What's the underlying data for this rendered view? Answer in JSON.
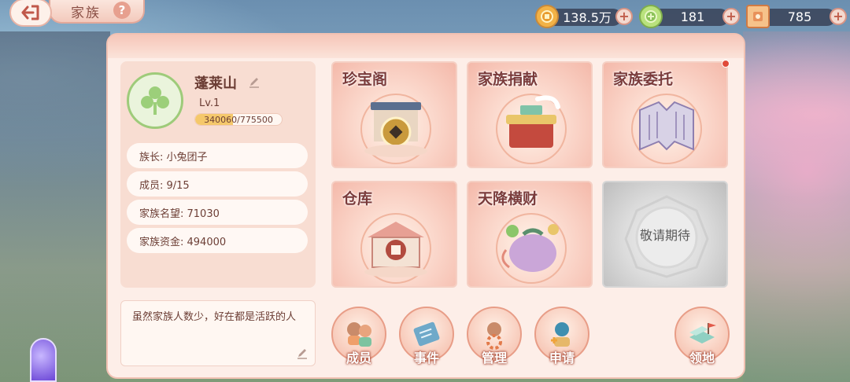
{
  "header": {
    "title": "家族",
    "help_label": "?"
  },
  "currencies": [
    {
      "icon": "gold-coin-icon",
      "value": "138.5万",
      "color": "#e7a33c"
    },
    {
      "icon": "jade-coin-icon",
      "value": "181",
      "color": "#9ccf5e"
    },
    {
      "icon": "scroll-ticket-icon",
      "value": "785",
      "color": "#e8915a"
    }
  ],
  "family": {
    "name": "蓬莱山",
    "level": "Lv.1",
    "exp_text": "340060/775500",
    "exp_fraction": 0.4385,
    "info_rows": [
      {
        "label": "族长: 小兔团子"
      },
      {
        "label": "成员: 9/15"
      },
      {
        "label": "家族名望: 71030"
      },
      {
        "label": "家族资金: 494000"
      }
    ],
    "notice": "虽然家族人数少，好在都是活跃的人"
  },
  "tiles": [
    {
      "title": "珍宝阁"
    },
    {
      "title": "家族捐献"
    },
    {
      "title": "家族委托"
    },
    {
      "title": "仓库"
    },
    {
      "title": "天降横财"
    },
    {
      "title": "敬请期待"
    }
  ],
  "bottom_buttons": [
    {
      "label": "成员"
    },
    {
      "label": "事件"
    },
    {
      "label": "管理"
    },
    {
      "label": "申请"
    },
    {
      "label": "领地"
    }
  ]
}
